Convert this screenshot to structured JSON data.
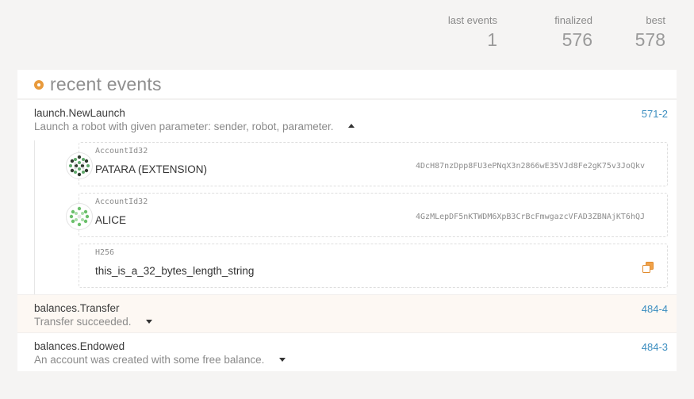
{
  "summary": {
    "last_events_label": "last events",
    "last_events_value": "1",
    "finalized_label": "finalized",
    "finalized_value": "576",
    "best_label": "best",
    "best_value": "578"
  },
  "card": {
    "title": "recent events",
    "icon": "orange-dot-icon"
  },
  "events": [
    {
      "name": "launch.NewLaunch",
      "description": "Launch a robot with given parameter: sender, robot, parameter.",
      "block": "571-2",
      "expanded": true,
      "params": [
        {
          "type": "AccountId32",
          "value": "PATARA (EXTENSION)",
          "address": "4DcH87nzDpp8FU3ePNqX3n2866wE35VJd8Fe2gK75v3JoQkv",
          "icon": "identicon"
        },
        {
          "type": "AccountId32",
          "value": "ALICE",
          "address": "4GzMLepDF5nKTWDM6XpB3CrBcFmwgazcVFAD3ZBNAjKT6hQJ",
          "icon": "identicon"
        },
        {
          "type": "H256",
          "value": "this_is_a_32_bytes_length_string",
          "icon": "copy-icon"
        }
      ]
    },
    {
      "name": "balances.Transfer",
      "description": "Transfer succeeded.",
      "block": "484-4",
      "expanded": false
    },
    {
      "name": "balances.Endowed",
      "description": "An account was created with some free balance.",
      "block": "484-3",
      "expanded": false
    }
  ],
  "colors": {
    "accent": "#e89a3c",
    "link": "#3c8ec0",
    "background": "#f5f4f3"
  }
}
